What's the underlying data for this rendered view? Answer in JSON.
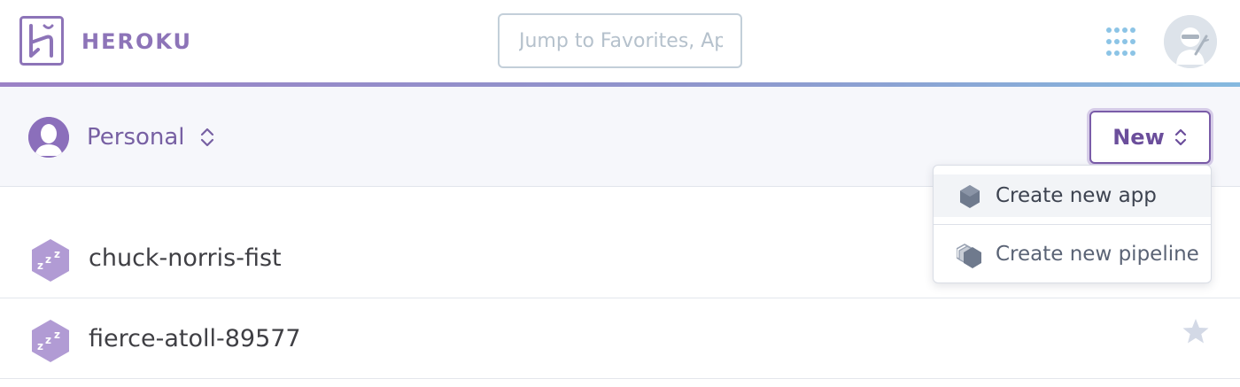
{
  "header": {
    "brand": "HEROKU",
    "search_placeholder": "Jump to Favorites, Apps, Pipelines, Spaces...",
    "icons": {
      "logo": "heroku-logo-icon",
      "apps_grid": "apps-grid-icon",
      "avatar": "user-avatar"
    }
  },
  "subheader": {
    "account_label": "Personal",
    "new_button_label": "New"
  },
  "dropdown": {
    "items": [
      {
        "label": "Create new app",
        "icon": "app-hexagon-icon"
      },
      {
        "label": "Create new pipeline",
        "icon": "pipeline-stack-icon"
      }
    ]
  },
  "apps": [
    {
      "name": "chuck-norris-fist",
      "status_icon": "sleeping-dyno-icon"
    },
    {
      "name": "fierce-atoll-89577",
      "status_icon": "sleeping-dyno-icon",
      "favorite_icon": "star-icon"
    }
  ],
  "colors": {
    "brand_purple": "#8d74b8",
    "accent_purple": "#6b4e9b",
    "gradient_start": "#9b82c6",
    "gradient_end": "#85b9df",
    "subheader_bg": "#f6f7fb"
  }
}
